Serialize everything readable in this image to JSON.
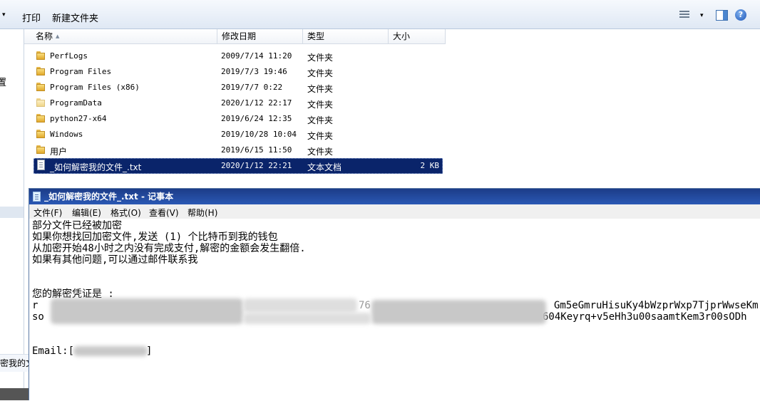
{
  "explorer": {
    "toolbar": {
      "print_label": "打印",
      "new_folder_label": "新建文件夹",
      "left_arrow": "▾",
      "views_dropdown": "▾",
      "help": "?"
    },
    "nav": {
      "partial_item": "置",
      "partial_file": "密我的文"
    },
    "columns": {
      "name": "名称",
      "date": "修改日期",
      "type": "类型",
      "size": "大小"
    },
    "files": [
      {
        "name": "PerfLogs",
        "date": "2009/7/14 11:20",
        "type": "文件夹",
        "size": "",
        "icon": "folder-icon"
      },
      {
        "name": "Program Files",
        "date": "2019/7/3 19:46",
        "type": "文件夹",
        "size": "",
        "icon": "folder-icon"
      },
      {
        "name": "Program Files (x86)",
        "date": "2019/7/7 0:22",
        "type": "文件夹",
        "size": "",
        "icon": "folder-icon"
      },
      {
        "name": "ProgramData",
        "date": "2020/1/12 22:17",
        "type": "文件夹",
        "size": "",
        "icon": "folder-icon-light"
      },
      {
        "name": "python27-x64",
        "date": "2019/6/24 12:35",
        "type": "文件夹",
        "size": "",
        "icon": "folder-icon"
      },
      {
        "name": "Windows",
        "date": "2019/10/28 10:04",
        "type": "文件夹",
        "size": "",
        "icon": "folder-icon"
      },
      {
        "name": "用户",
        "date": "2019/6/15 11:50",
        "type": "文件夹",
        "size": "",
        "icon": "folder-icon"
      },
      {
        "name": "_如何解密我的文件_.txt",
        "date": "2020/1/12 22:21",
        "type": "文本文档",
        "size": "2 KB",
        "icon": "text-file-icon",
        "selected": true
      }
    ]
  },
  "notepad": {
    "title": "_如何解密我的文件_.txt - 记事本",
    "menu": {
      "file": "文件(F)",
      "edit": "编辑(E)",
      "format": "格式(O)",
      "view": "查看(V)",
      "help": "帮助(H)"
    },
    "content": {
      "line1": "部分文件已经被加密",
      "line2": "如果你想找回加密文件,发送 (1) 个比特币到我的钱包",
      "line3": "从加密开始48小时之内没有完成支付,解密的金额会发生翻倍.",
      "line4": "如果有其他问题,可以通过邮件联系我",
      "key_label": "您的解密凭证是 :",
      "key_line1_start": "r",
      "key_line1_mid": "76",
      "key_line1_end": "Gm5eGmruHisuKy4bWzprWxp7TjprWwseKm",
      "key_line2_start": "so",
      "key_line2_end": "604Keyrq+v5eHh3u00saamtKem3r00sODh",
      "email_prefix": "Email:[",
      "email_suffix": "]"
    }
  }
}
